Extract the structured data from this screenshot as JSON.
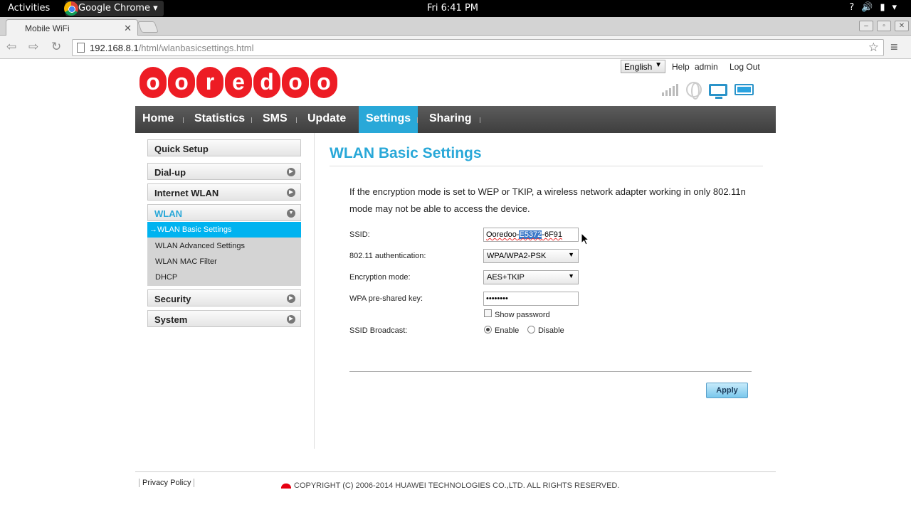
{
  "system_bar": {
    "activities": "Activities",
    "app_name": "Google Chrome",
    "clock": "Fri  6:41 PM"
  },
  "browser": {
    "tab_title": "Mobile WiFi",
    "url_host": "192.168.8.1",
    "url_path": "/html/wlanbasicsettings.html"
  },
  "header": {
    "language": "English",
    "help": "Help",
    "user": "admin",
    "logout": "Log Out",
    "logo_letters": [
      "o",
      "o",
      "r",
      "e",
      "d",
      "o",
      "o"
    ],
    "battery_level": 1.0
  },
  "nav": {
    "items": [
      "Home",
      "Statistics",
      "SMS",
      "Update",
      "Settings",
      "Sharing"
    ],
    "active": "Settings"
  },
  "sidebar": {
    "items": [
      "Quick Setup",
      "Dial-up",
      "Internet WLAN",
      "WLAN",
      "Security",
      "System"
    ],
    "wlan_sub": [
      "WLAN Basic Settings",
      "WLAN Advanced Settings",
      "WLAN MAC Filter",
      "DHCP"
    ],
    "active_sub_prefix": "→"
  },
  "content": {
    "title": "WLAN Basic Settings",
    "notice": "If the encryption mode is set to WEP or TKIP, a wireless network adapter working in only 802.11n mode may not be able to access the device.",
    "ssid_label": "SSID:",
    "ssid_parts": [
      "Ooredoo-",
      "E5372",
      "-6F91"
    ],
    "auth_label": "802.11 authentication:",
    "auth_value": "WPA/WPA2-PSK",
    "enc_label": "Encryption mode:",
    "enc_value": "AES+TKIP",
    "psk_label": "WPA pre-shared key:",
    "psk_value": "••••••••",
    "show_password": "Show password",
    "broadcast_label": "SSID Broadcast:",
    "enable": "Enable",
    "disable": "Disable",
    "apply": "Apply"
  },
  "footer": {
    "privacy": "Privacy Policy",
    "copyright": "COPYRIGHT (C) 2006-2014 HUAWEI TECHNOLOGIES CO.,LTD. ALL RIGHTS RESERVED."
  }
}
